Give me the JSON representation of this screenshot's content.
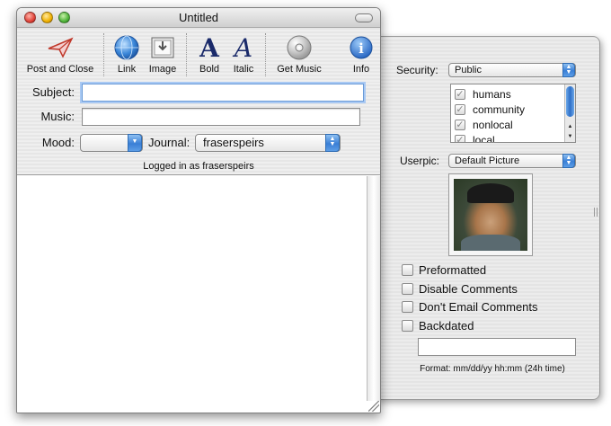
{
  "window": {
    "title": "Untitled"
  },
  "toolbar": {
    "post_label": "Post and Close",
    "link_label": "Link",
    "image_label": "Image",
    "bold_label": "Bold",
    "bold_glyph": "A",
    "italic_label": "Italic",
    "italic_glyph": "A",
    "music_label": "Get Music",
    "info_label": "Info",
    "info_glyph": "i"
  },
  "form": {
    "subject_label": "Subject:",
    "subject_value": "",
    "music_label": "Music:",
    "music_value": "",
    "mood_label": "Mood:",
    "mood_value": "",
    "journal_label": "Journal:",
    "journal_value": "fraserspeirs",
    "logged_in": "Logged in as fraserspeirs"
  },
  "drawer": {
    "security_label": "Security:",
    "security_value": "Public",
    "groups": [
      {
        "name": "humans",
        "checked": true
      },
      {
        "name": "community",
        "checked": true
      },
      {
        "name": "nonlocal",
        "checked": true
      },
      {
        "name": "local",
        "checked": true
      }
    ],
    "userpic_label": "Userpic:",
    "userpic_value": "Default Picture",
    "options": [
      "Preformatted",
      "Disable Comments",
      "Don't Email Comments",
      "Backdated"
    ],
    "date_value": "",
    "format_hint": "Format: mm/dd/yy hh:mm (24h time)"
  },
  "icons": {
    "post": "paper-plane-icon",
    "link": "globe-icon",
    "image": "picture-icon",
    "bold": "bold-a-icon",
    "italic": "italic-a-icon",
    "music": "cd-icon",
    "info": "info-icon"
  },
  "colors": {
    "accent_blue": "#3a7fd6",
    "focus_ring": "#a9c9f3",
    "close_red": "#e0443a",
    "minimize_yellow": "#f0b000",
    "zoom_green": "#4fb43a"
  }
}
